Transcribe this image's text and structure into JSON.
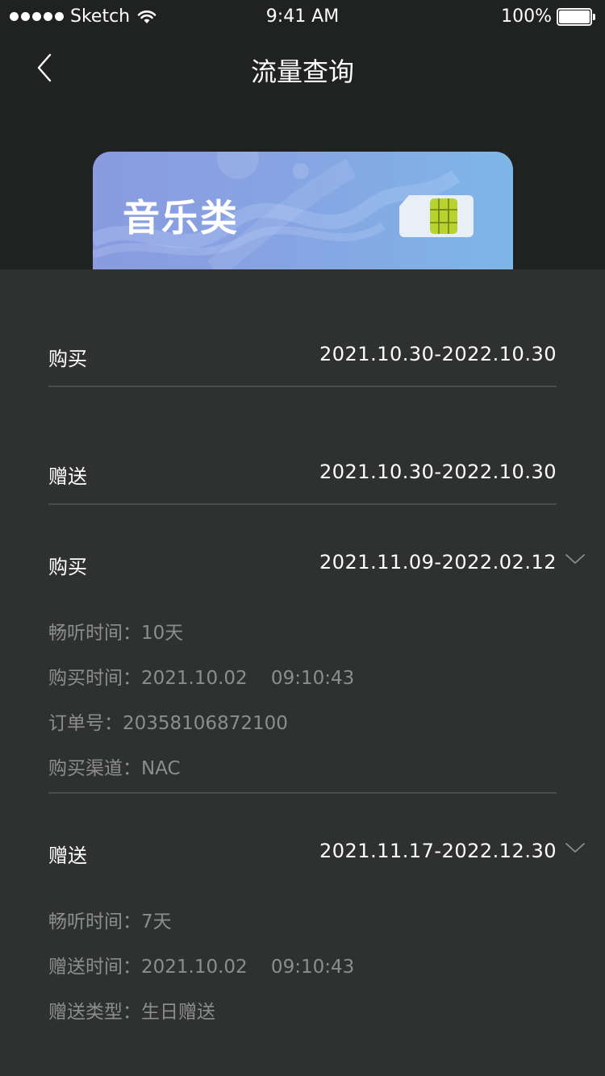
{
  "status_bar": {
    "carrier": "Sketch",
    "time": "9:41 AM",
    "battery": "100%"
  },
  "nav": {
    "title": "流量查询"
  },
  "card": {
    "title": "音乐类"
  },
  "records": [
    {
      "label": "购买",
      "range": "2021.10.30-2022.10.30"
    },
    {
      "label": "赠送",
      "range": "2021.10.30-2022.10.30"
    },
    {
      "label": "购买",
      "range": "2021.11.09-2022.02.12",
      "details": [
        "畅听时间：10天",
        "购买时间：2021.10.02    09:10:43",
        "订单号：20358106872100",
        "购买渠道：NAC"
      ]
    },
    {
      "label": "赠送",
      "range": "2021.11.17-2022.12.30",
      "details": [
        "畅听时间：7天",
        "赠送时间：2021.10.02    09:10:43",
        "赠送类型：生日赠送"
      ]
    }
  ]
}
